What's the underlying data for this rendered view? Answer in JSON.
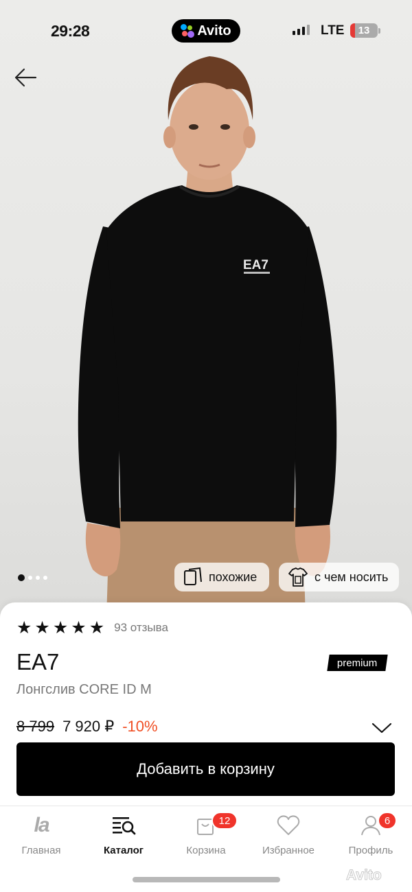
{
  "status_bar": {
    "time": "29:28",
    "app": "Avito",
    "network": "LTE",
    "battery": "13"
  },
  "gallery": {
    "image_count": 4,
    "active_image": 1,
    "shirt_logo": "EA7",
    "similar_label": "похожие",
    "wear_with_label": "с чем носить"
  },
  "product": {
    "rating_stars": 5,
    "reviews": "93 отзыва",
    "brand": "EA7",
    "badge": "premium",
    "name": "Лонгслив CORE ID M",
    "old_price": "8 799",
    "price": "7 920 ₽",
    "discount": "-10%",
    "cart_button": "Добавить в корзину"
  },
  "bottom_nav": {
    "items": [
      {
        "label": "Главная",
        "icon": "lamoda-logo-icon"
      },
      {
        "label": "Каталог",
        "icon": "catalog-search-icon"
      },
      {
        "label": "Корзина",
        "icon": "bag-icon",
        "badge": "12"
      },
      {
        "label": "Избранное",
        "icon": "heart-icon"
      },
      {
        "label": "Профиль",
        "icon": "profile-icon",
        "badge": "6"
      }
    ]
  },
  "watermark": "Avito",
  "colors": {
    "accent": "#f04e23",
    "badge": "#f0342b",
    "primary_button": "#000000",
    "shirt": "#0d0d0d",
    "trousers": "#b8916f"
  }
}
